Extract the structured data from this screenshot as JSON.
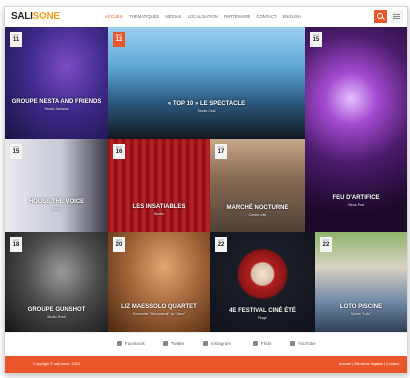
{
  "header": {
    "logo_main": "SALI",
    "logo_accent": "SONE",
    "nav": [
      "ACCUEIL",
      "THÉMATIQUES",
      "MÉDIAS",
      "LOCALISATION",
      "PARTENAIRE",
      "CONTACT",
      "ENGLISH"
    ],
    "active_nav_index": 0
  },
  "tiles": [
    {
      "month": "SEPT",
      "day": "11",
      "title": "GROUPE NESTA AND FRIENDS",
      "subtitle": "Studio Jamaica"
    },
    {
      "month": "SEPT",
      "day": "12",
      "title": "« TOP 10 » LE SPECTACLE",
      "subtitle": "Studio Club",
      "highlight": true
    },
    {
      "month": "SEPT",
      "day": "15",
      "title": "FEU D'ARTIFICE",
      "subtitle": "Vieux-Port"
    },
    {
      "month": "SEPT",
      "day": "15",
      "title": "HOUSE THE VOICE",
      "subtitle": "Studio"
    },
    {
      "month": "SEPT",
      "day": "16",
      "title": "LES INSATIABLES",
      "subtitle": "Studio"
    },
    {
      "month": "SEPT",
      "day": "17",
      "title": "MARCHÉ NOCTURNE",
      "subtitle": "Centre-ville"
    },
    {
      "month": "SEPT",
      "day": "18",
      "title": "GROUPE GUNSHOT",
      "subtitle": "Studio Rock"
    },
    {
      "month": "SEPT",
      "day": "20",
      "title": "LIZ MAESSOLO QUARTET",
      "subtitle": "Ensemble \"Déconstruit\" au \"Jazz\""
    },
    {
      "month": "SEPT",
      "day": "22",
      "title": "4e FESTIVAL CINÉ ÉTÉ",
      "subtitle": "Plage"
    },
    {
      "month": "SEPT",
      "day": "22",
      "title": "LOTO PISCINE",
      "subtitle": "Soirée \"Loto\""
    }
  ],
  "social": [
    {
      "icon": "facebook-icon",
      "label": "Facebook"
    },
    {
      "icon": "twitter-icon",
      "label": "Twitter"
    },
    {
      "icon": "instagram-icon",
      "label": "Instagram"
    },
    {
      "icon": "flickr-icon",
      "label": "Flickr"
    },
    {
      "icon": "youtube-icon",
      "label": "YouTube"
    }
  ],
  "footer": {
    "copyright": "Copyright © sali-sone, 2016",
    "links": "Accueil | Mentions légales | Contact"
  },
  "colors": {
    "accent": "#e8562a",
    "logo_accent": "#f0a31a"
  }
}
